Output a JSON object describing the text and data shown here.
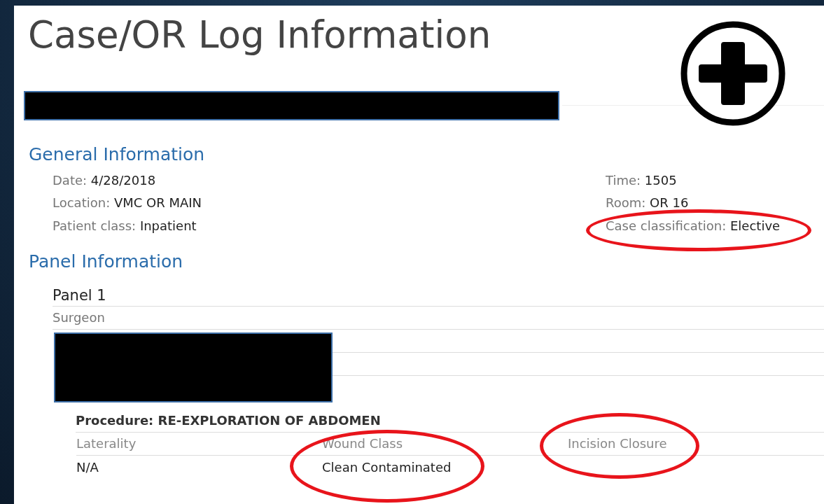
{
  "title": "Case/OR Log Information",
  "general": {
    "heading": "General Information",
    "left": [
      {
        "label": "Date:",
        "value": "4/28/2018",
        "circled": false
      },
      {
        "label": "Location:",
        "value": "VMC OR MAIN",
        "circled": false
      },
      {
        "label": "Patient class:",
        "value": "Inpatient",
        "circled": false
      }
    ],
    "right": [
      {
        "label": "Time:",
        "value": "1505",
        "circled": false
      },
      {
        "label": "Room:",
        "value": "OR 16",
        "circled": false
      },
      {
        "label": "Case classification:",
        "value": "Elective",
        "circled": true
      }
    ]
  },
  "panel_info": {
    "heading": "Panel Information",
    "panel_title": "Panel 1",
    "surgeon_label": "Surgeon",
    "procedure": "Procedure: RE-EXPLORATION OF ABDOMEN",
    "columns": [
      {
        "heading": "Laterality",
        "value": "N/A",
        "circled": false
      },
      {
        "heading": "Wound Class",
        "value": "Clean Contaminated",
        "circled": true
      },
      {
        "heading": "Incision Closure",
        "circled": true
      }
    ]
  }
}
